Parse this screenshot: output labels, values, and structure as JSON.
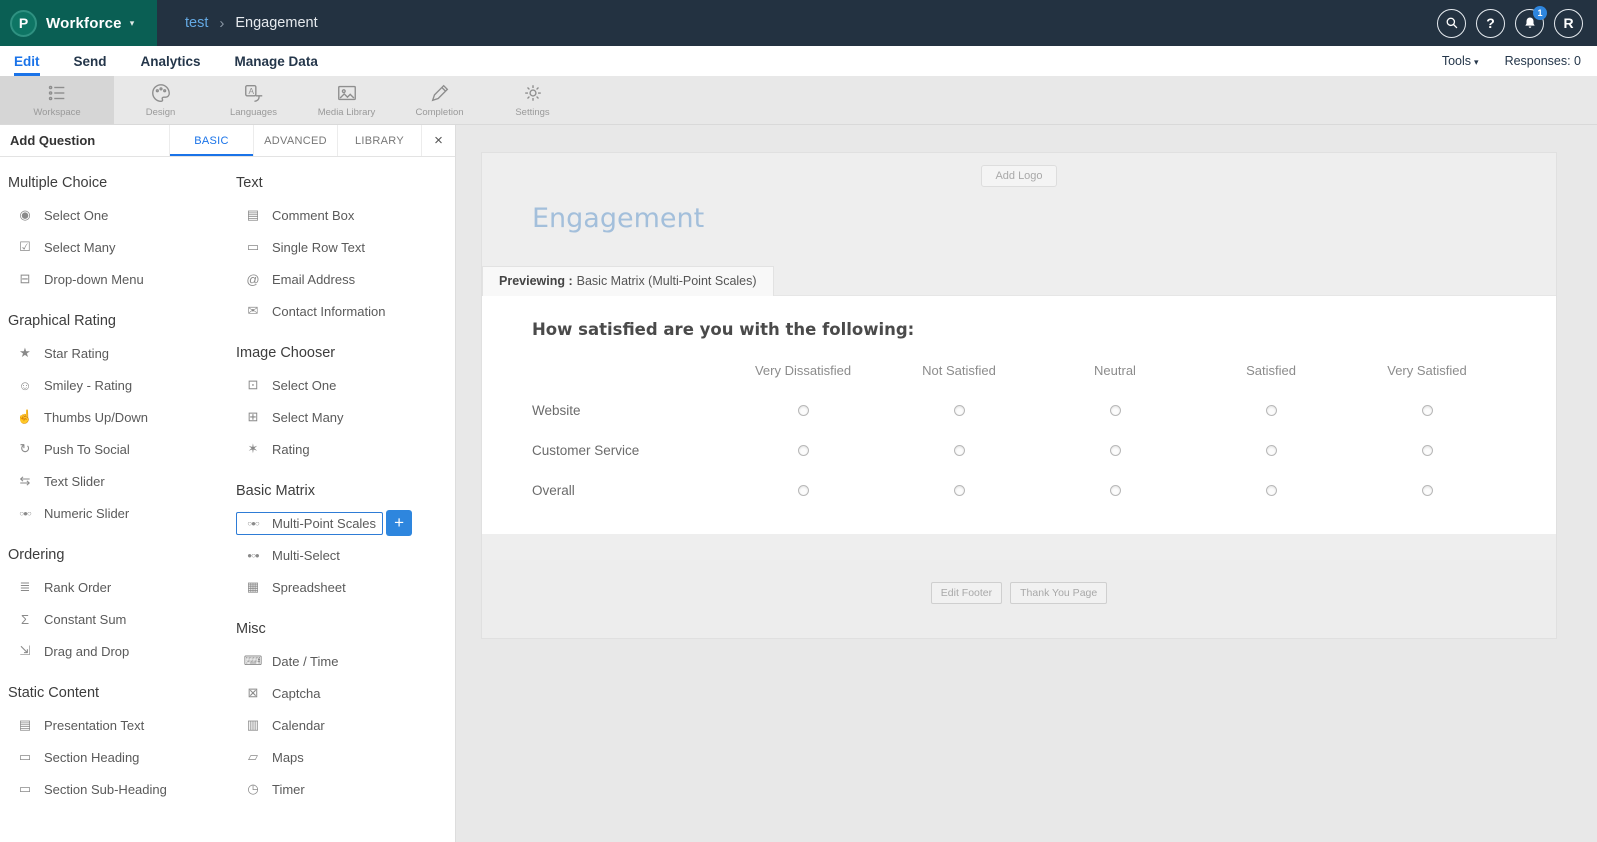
{
  "colors": {
    "topbar_bg": "#233241",
    "brand_teal": "#0a5f54",
    "accent_blue": "#1a73e8",
    "button_blue": "#2e86de",
    "survey_title_blue": "#a3bfdb"
  },
  "topbar": {
    "logo_letter": "P",
    "brand": "Workforce",
    "brand_caret": "▾",
    "breadcrumb": {
      "project": "test",
      "separator": "›",
      "page": "Engagement"
    },
    "help_glyph": "?",
    "notification_badge": "1",
    "avatar_initial": "R"
  },
  "menubar": {
    "tabs": [
      {
        "label": "Edit",
        "active": true
      },
      {
        "label": "Send",
        "active": false
      },
      {
        "label": "Analytics",
        "active": false
      },
      {
        "label": "Manage Data",
        "active": false
      }
    ],
    "tools": "Tools",
    "tools_caret": "▾",
    "responses": "Responses: 0"
  },
  "toolbar": {
    "items": [
      {
        "label": "Workspace",
        "active": true
      },
      {
        "label": "Design",
        "active": false
      },
      {
        "label": "Languages",
        "active": false
      },
      {
        "label": "Media Library",
        "active": false
      },
      {
        "label": "Completion",
        "active": false
      },
      {
        "label": "Settings",
        "active": false
      }
    ]
  },
  "panel": {
    "title": "Add Question",
    "tabs": [
      {
        "label": "BASIC",
        "active": true
      },
      {
        "label": "ADVANCED",
        "active": false
      },
      {
        "label": "LIBRARY",
        "active": false
      }
    ],
    "close": "×",
    "add_plus": "+",
    "left_groups": [
      {
        "title": "Multiple Choice",
        "items": [
          {
            "label": "Select One",
            "icon": "radio-select-one-icon",
            "glyph": "◉"
          },
          {
            "label": "Select Many",
            "icon": "checkbox-select-many-icon",
            "glyph": "☑"
          },
          {
            "label": "Drop-down Menu",
            "icon": "dropdown-menu-icon",
            "glyph": "⊟"
          }
        ]
      },
      {
        "title": "Graphical Rating",
        "items": [
          {
            "label": "Star Rating",
            "icon": "star-rating-icon",
            "glyph": "★"
          },
          {
            "label": "Smiley - Rating",
            "icon": "smiley-rating-icon",
            "glyph": "☺"
          },
          {
            "label": "Thumbs Up/Down",
            "icon": "thumbs-up-down-icon",
            "glyph": "☝"
          },
          {
            "label": "Push To Social",
            "icon": "push-to-social-icon",
            "glyph": "↻"
          },
          {
            "label": "Text Slider",
            "icon": "text-slider-icon",
            "glyph": "⇆"
          },
          {
            "label": "Numeric Slider",
            "icon": "numeric-slider-icon",
            "glyph": "○●○"
          }
        ]
      },
      {
        "title": "Ordering",
        "items": [
          {
            "label": "Rank Order",
            "icon": "rank-order-icon",
            "glyph": "≣"
          },
          {
            "label": "Constant Sum",
            "icon": "constant-sum-icon",
            "glyph": "Σ"
          },
          {
            "label": "Drag and Drop",
            "icon": "drag-and-drop-icon",
            "glyph": "⇲"
          }
        ]
      },
      {
        "title": "Static Content",
        "items": [
          {
            "label": "Presentation Text",
            "icon": "presentation-text-icon",
            "glyph": "▤"
          },
          {
            "label": "Section Heading",
            "icon": "section-heading-icon",
            "glyph": "▭"
          },
          {
            "label": "Section Sub-Heading",
            "icon": "section-subheading-icon",
            "glyph": "▭"
          }
        ]
      }
    ],
    "right_groups": [
      {
        "title": "Text",
        "items": [
          {
            "label": "Comment Box",
            "icon": "comment-box-icon",
            "glyph": "▤"
          },
          {
            "label": "Single Row Text",
            "icon": "single-row-text-icon",
            "glyph": "▭"
          },
          {
            "label": "Email Address",
            "icon": "email-address-icon",
            "glyph": "@"
          },
          {
            "label": "Contact Information",
            "icon": "contact-information-icon",
            "glyph": "✉"
          }
        ]
      },
      {
        "title": "Image Chooser",
        "items": [
          {
            "label": "Select One",
            "icon": "image-select-one-icon",
            "glyph": "⊡"
          },
          {
            "label": "Select Many",
            "icon": "image-select-many-icon",
            "glyph": "⊞"
          },
          {
            "label": "Rating",
            "icon": "image-rating-icon",
            "glyph": "✶"
          }
        ]
      },
      {
        "title": "Basic Matrix",
        "items": [
          {
            "label": "Multi-Point Scales",
            "icon": "multi-point-scales-icon",
            "glyph": "○●○",
            "selected": true
          },
          {
            "label": "Multi-Select",
            "icon": "multi-select-icon",
            "glyph": "●○●"
          },
          {
            "label": "Spreadsheet",
            "icon": "spreadsheet-icon",
            "glyph": "▦"
          }
        ]
      },
      {
        "title": "Misc",
        "items": [
          {
            "label": "Date / Time",
            "icon": "date-time-icon",
            "glyph": "⌨"
          },
          {
            "label": "Captcha",
            "icon": "captcha-icon",
            "glyph": "⊠"
          },
          {
            "label": "Calendar",
            "icon": "calendar-icon",
            "glyph": "▥"
          },
          {
            "label": "Maps",
            "icon": "maps-icon",
            "glyph": "▱"
          },
          {
            "label": "Timer",
            "icon": "timer-icon",
            "glyph": "◷"
          }
        ]
      }
    ]
  },
  "preview": {
    "add_logo_label": "Add Logo",
    "title": "Engagement",
    "previewing_label": "Previewing :",
    "previewing_value": "Basic Matrix (Multi-Point Scales)",
    "question": "How satisfied are you with the following:",
    "matrix": {
      "columns": [
        "Very Dissatisfied",
        "Not Satisfied",
        "Neutral",
        "Satisfied",
        "Very Satisfied"
      ],
      "rows": [
        {
          "label": "Website"
        },
        {
          "label": "Customer Service"
        },
        {
          "label": "Overall"
        }
      ]
    },
    "footer_buttons": [
      {
        "label": "Edit Footer"
      },
      {
        "label": "Thank You Page"
      }
    ]
  }
}
